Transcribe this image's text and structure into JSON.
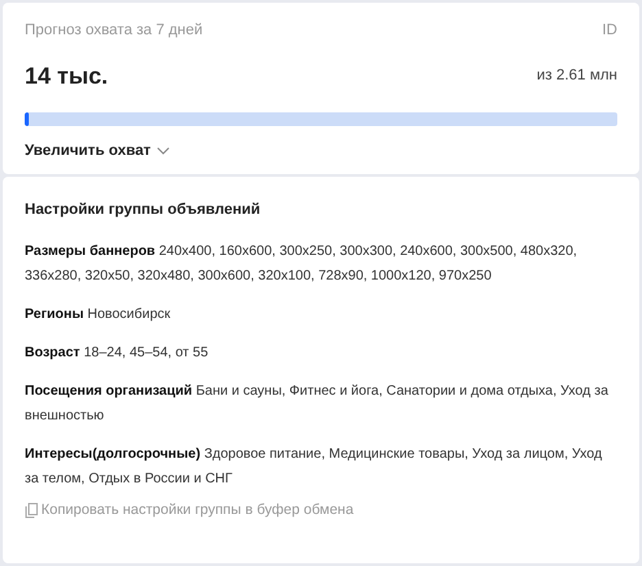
{
  "forecast": {
    "title": "Прогноз охвата за 7 дней",
    "id_label": "ID",
    "value": "14 тыс.",
    "total": "из 2.61 млн",
    "level": 0.006,
    "expand_link": "Увеличить охват",
    "expanded": false
  },
  "settings": {
    "title": "Настройки группы объявлений",
    "items": [
      {
        "label": "Размеры баннеров",
        "value": "240x400, 160x600, 300x250, 300x300, 240x600, 300x500, 480x320, 336x280, 320x50, 320x480, 300x600, 320x100, 728x90, 1000x120, 970x250"
      },
      {
        "label": "Регионы",
        "value": "Новосибирск"
      },
      {
        "label": "Возраст",
        "value": "18–24, 45–54, от 55"
      },
      {
        "label": "Посещения организаций",
        "value": "Бани и сауны, Фитнес и йога, Санатории и дома отдыха, Уход за внешностью"
      },
      {
        "label": "Интересы(долгосрочные)",
        "value": "Здоровое питание, Медицинские товары, Уход за лицом, Уход за телом, Отдых в России и СНГ"
      }
    ],
    "copy_link": "Копировать настройки группы в буфер обмена"
  }
}
